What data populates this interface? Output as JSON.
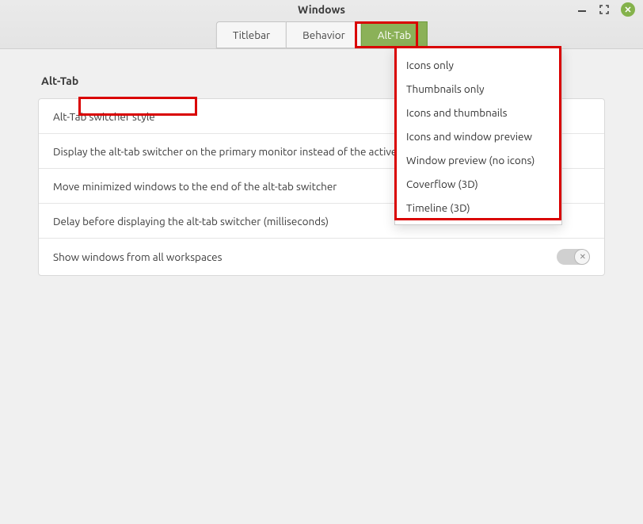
{
  "window": {
    "title": "Windows"
  },
  "tabs": {
    "titlebar": "Titlebar",
    "behavior": "Behavior",
    "alttab": "Alt-Tab"
  },
  "section": {
    "heading": "Alt-Tab"
  },
  "rows": {
    "switcher_style": "Alt-Tab switcher style",
    "primary_monitor": "Display the alt-tab switcher on the primary monitor instead of the active one",
    "move_minimized": "Move minimized windows to the end of the alt-tab switcher",
    "delay": "Delay before displaying the alt-tab switcher (milliseconds)",
    "all_workspaces": "Show windows from all workspaces"
  },
  "dropdown": {
    "items": [
      "Icons only",
      "Thumbnails only",
      "Icons and thumbnails",
      "Icons and window preview",
      "Window preview (no icons)",
      "Coverflow (3D)",
      "Timeline (3D)"
    ]
  }
}
